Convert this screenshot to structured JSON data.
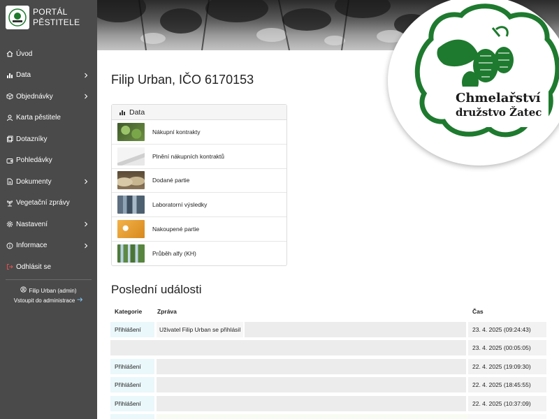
{
  "brand": {
    "line1": "PORTÁL",
    "line2": "PĚSTITELE"
  },
  "sidebar": {
    "items": [
      {
        "label": "Úvod",
        "icon": "home-icon",
        "has_submenu": false
      },
      {
        "label": "Data",
        "icon": "bar-chart-icon",
        "has_submenu": true
      },
      {
        "label": "Objednávky",
        "icon": "box-icon",
        "has_submenu": true
      },
      {
        "label": "Karta pěstitele",
        "icon": "user-icon",
        "has_submenu": false
      },
      {
        "label": "Dotazníky",
        "icon": "forms-icon",
        "has_submenu": false
      },
      {
        "label": "Pohledávky",
        "icon": "wallet-icon",
        "has_submenu": false
      },
      {
        "label": "Dokumenty",
        "icon": "document-icon",
        "has_submenu": true
      },
      {
        "label": "Vegetační zprávy",
        "icon": "plant-icon",
        "has_submenu": false
      },
      {
        "label": "Nastavení",
        "icon": "gear-icon",
        "has_submenu": true
      },
      {
        "label": "Informace",
        "icon": "info-icon",
        "has_submenu": true
      },
      {
        "label": "Odhlásit se",
        "icon": "logout-icon",
        "has_submenu": false
      }
    ],
    "user": "Filip Urban (admin)",
    "admin_link": "Vstoupit do administrace"
  },
  "logo": {
    "line1": "Chmelařství",
    "line2": "družstvo Žatec"
  },
  "main": {
    "title": "Filip Urban, IČO 6170153",
    "data_card": {
      "heading": "Data",
      "items": [
        {
          "label": "Nákupní kontrakty"
        },
        {
          "label": "Plnění nákupních kontraktů"
        },
        {
          "label": "Dodané partie"
        },
        {
          "label": "Laboratorní výsledky"
        },
        {
          "label": "Nakoupené partie"
        },
        {
          "label": "Průběh alfy (KH)"
        }
      ]
    },
    "events": {
      "title": "Poslední události",
      "columns": [
        "Kategorie",
        "Zpráva",
        "Čas"
      ],
      "rows": [
        {
          "kategorie": "Přihlášení",
          "zprava": "Uživatel Filip Urban se přihlásil",
          "cas": "23. 4. 2025 (09:24:43)"
        },
        {
          "kategorie": "",
          "zprava": "",
          "cas": "23. 4. 2025 (00:05:05)"
        },
        {
          "kategorie": "Přihlášení",
          "zprava": "",
          "cas": "22. 4. 2025 (19:09:30)"
        },
        {
          "kategorie": "Přihlášení",
          "zprava": "",
          "cas": "22. 4. 2025 (18:45:55)"
        },
        {
          "kategorie": "Přihlášení",
          "zprava": "",
          "cas": "22. 4. 2025 (10:37:09)"
        }
      ]
    }
  },
  "colors": {
    "sidebar_bg": "#4a4a4a",
    "logo_green": "#1e7a2e",
    "kategorie_bg": "#eaf7fb",
    "logout_icon": "#e05050"
  }
}
